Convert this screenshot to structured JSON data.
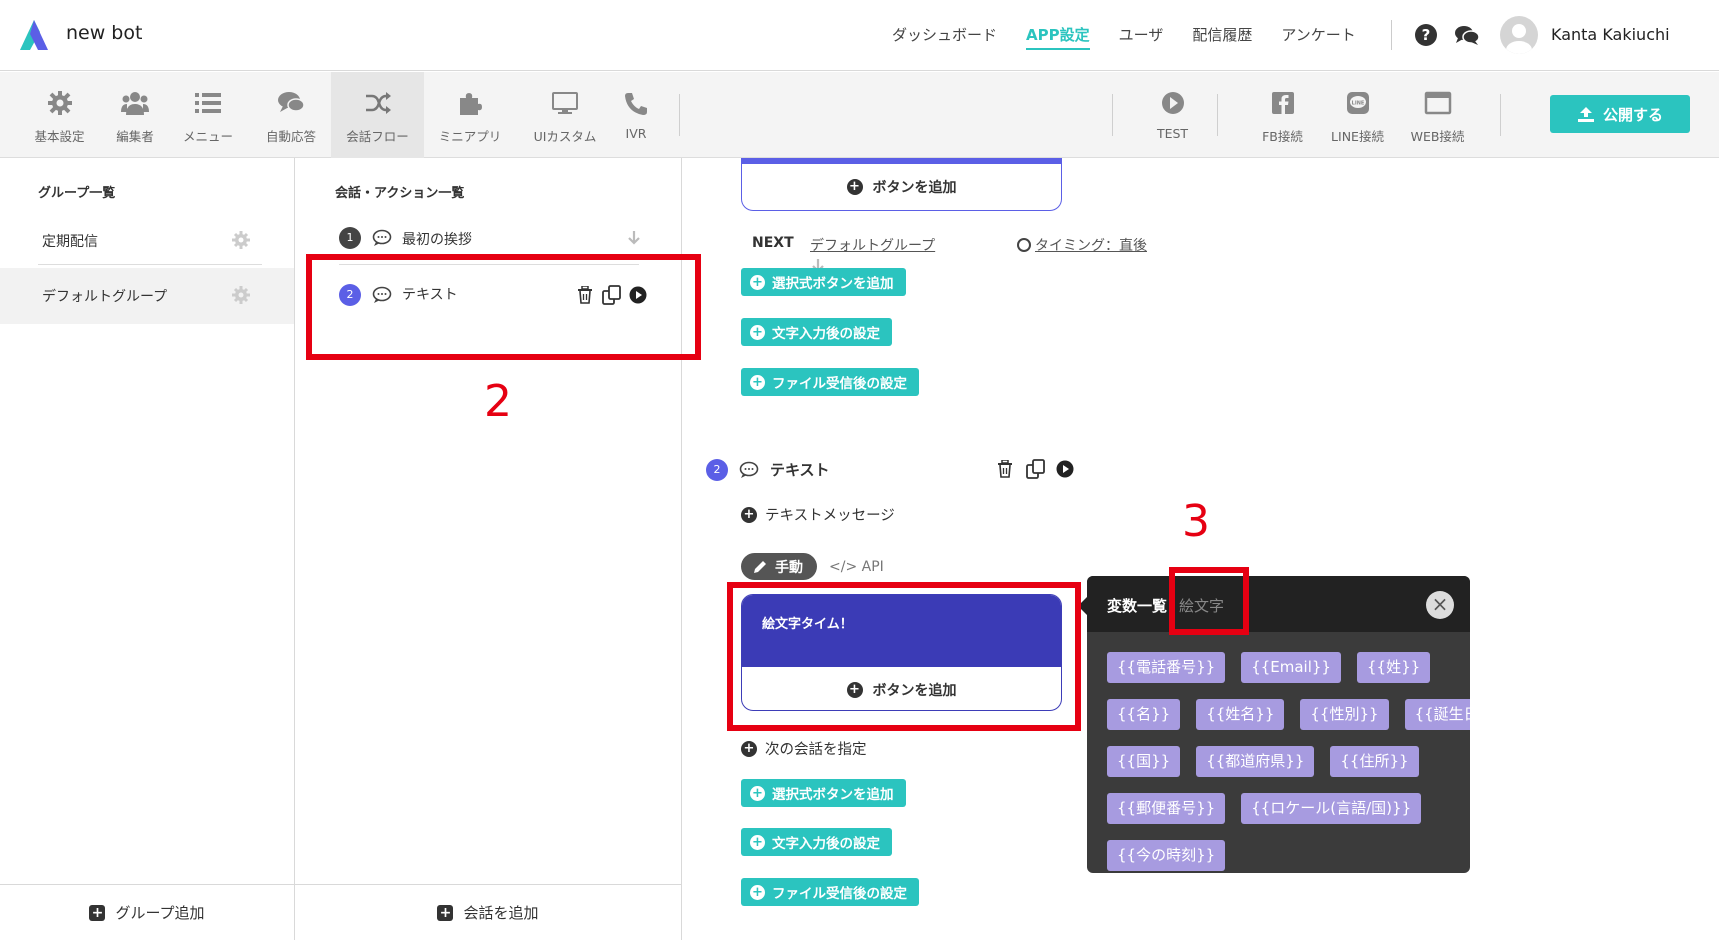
{
  "header": {
    "brand": "new bot",
    "nav": [
      "ダッシュボード",
      "APP設定",
      "ユーザ",
      "配信履歴",
      "アンケート"
    ],
    "active_nav": "APP設定",
    "help_icon": "?",
    "username": "Kanta Kakiuchi"
  },
  "toolbar": {
    "tools": [
      {
        "label": "基本設定",
        "icon": "gear-icon"
      },
      {
        "label": "編集者",
        "icon": "users-icon"
      },
      {
        "label": "メニュー",
        "icon": "list-icon"
      },
      {
        "label": "自動応答",
        "icon": "chat-icon"
      },
      {
        "label": "会話フロー",
        "icon": "shuffle-icon"
      },
      {
        "label": "ミニアプリ",
        "icon": "puzzle-icon"
      },
      {
        "label": "UIカスタム",
        "icon": "monitor-icon"
      },
      {
        "label": "IVR",
        "icon": "phone-icon"
      }
    ],
    "right_tools": [
      {
        "label": "TEST",
        "icon": "play-icon"
      },
      {
        "label": "FB接続",
        "icon": "facebook-icon"
      },
      {
        "label": "LINE接続",
        "icon": "line-icon"
      },
      {
        "label": "WEB接続",
        "icon": "window-icon"
      }
    ],
    "publish_label": "公開する"
  },
  "groups": {
    "title": "グループ一覧",
    "items": [
      "定期配信",
      "デフォルトグループ"
    ],
    "add_label": "グループ追加"
  },
  "conversations": {
    "title": "会話・アクション一覧",
    "items": [
      {
        "num": "1",
        "label": "最初の挨拶"
      },
      {
        "num": "2",
        "label": "テキスト"
      }
    ],
    "add_label": "会話を追加"
  },
  "main": {
    "add_button_label": "ボタンを追加",
    "next_label": "NEXT",
    "next_target": "デフォルトグループ",
    "timing": "タイミング：直後",
    "actions": [
      "選択式ボタンを追加",
      "文字入力後の設定",
      "ファイル受信後の設定"
    ],
    "conv_num": "2",
    "conv_title": "テキスト",
    "text_message_label": "テキストメッセージ",
    "mode_manual": "手動",
    "mode_api": "API",
    "message_text": "絵文字タイム！",
    "next_conv_label": "次の会話を指定"
  },
  "annotations": {
    "label_2": "2",
    "label_3": "3"
  },
  "variable_panel": {
    "tab_variables": "変数一覧",
    "tab_emoji": "絵文字",
    "rows": [
      [
        "{{電話番号}}",
        "{{Email}}",
        "{{姓}}"
      ],
      [
        "{{名}}",
        "{{姓名}}",
        "{{性別}}",
        "{{誕生日}}"
      ],
      [
        "{{国}}",
        "{{都道府県}}",
        "{{住所}}"
      ],
      [
        "{{郵便番号}}",
        "{{ロケール(言語/国)}}"
      ],
      [
        "{{今の時刻}}"
      ]
    ]
  },
  "colors": {
    "accent": "#2bc4bf",
    "purple": "#5b5fe6",
    "message_bg": "#3b3bb6",
    "chip": "#a79be0",
    "annotation": "#e60012"
  }
}
